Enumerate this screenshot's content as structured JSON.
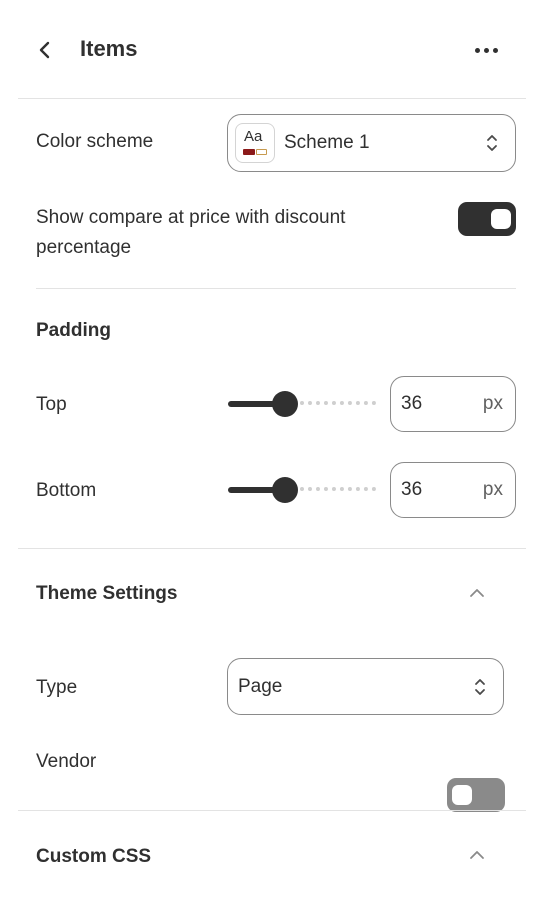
{
  "header": {
    "title": "Items",
    "back_icon": "chevron-left-icon",
    "more_icon": "more-horizontal-icon"
  },
  "color_scheme": {
    "label": "Color scheme",
    "swatch_text": "Aa",
    "value": "Scheme 1",
    "swatch_colors": [
      "#8b1a1a",
      "#c79a4f"
    ]
  },
  "compare_price": {
    "label_line1": "Show compare at price with discount",
    "label_line2": "percentage",
    "enabled": true
  },
  "padding": {
    "heading": "Padding",
    "top": {
      "label": "Top",
      "value": "36",
      "unit": "px"
    },
    "bottom": {
      "label": "Bottom",
      "value": "36",
      "unit": "px"
    }
  },
  "theme_settings": {
    "heading": "Theme Settings",
    "type": {
      "label": "Type",
      "value": "Page"
    },
    "vendor": {
      "label": "Vendor",
      "enabled": false
    }
  },
  "custom_css": {
    "heading": "Custom CSS"
  },
  "colors": {
    "text": "#303030",
    "toggle_on": "#303030",
    "toggle_off": "#8a8a8a",
    "border": "#8a8a8a"
  }
}
